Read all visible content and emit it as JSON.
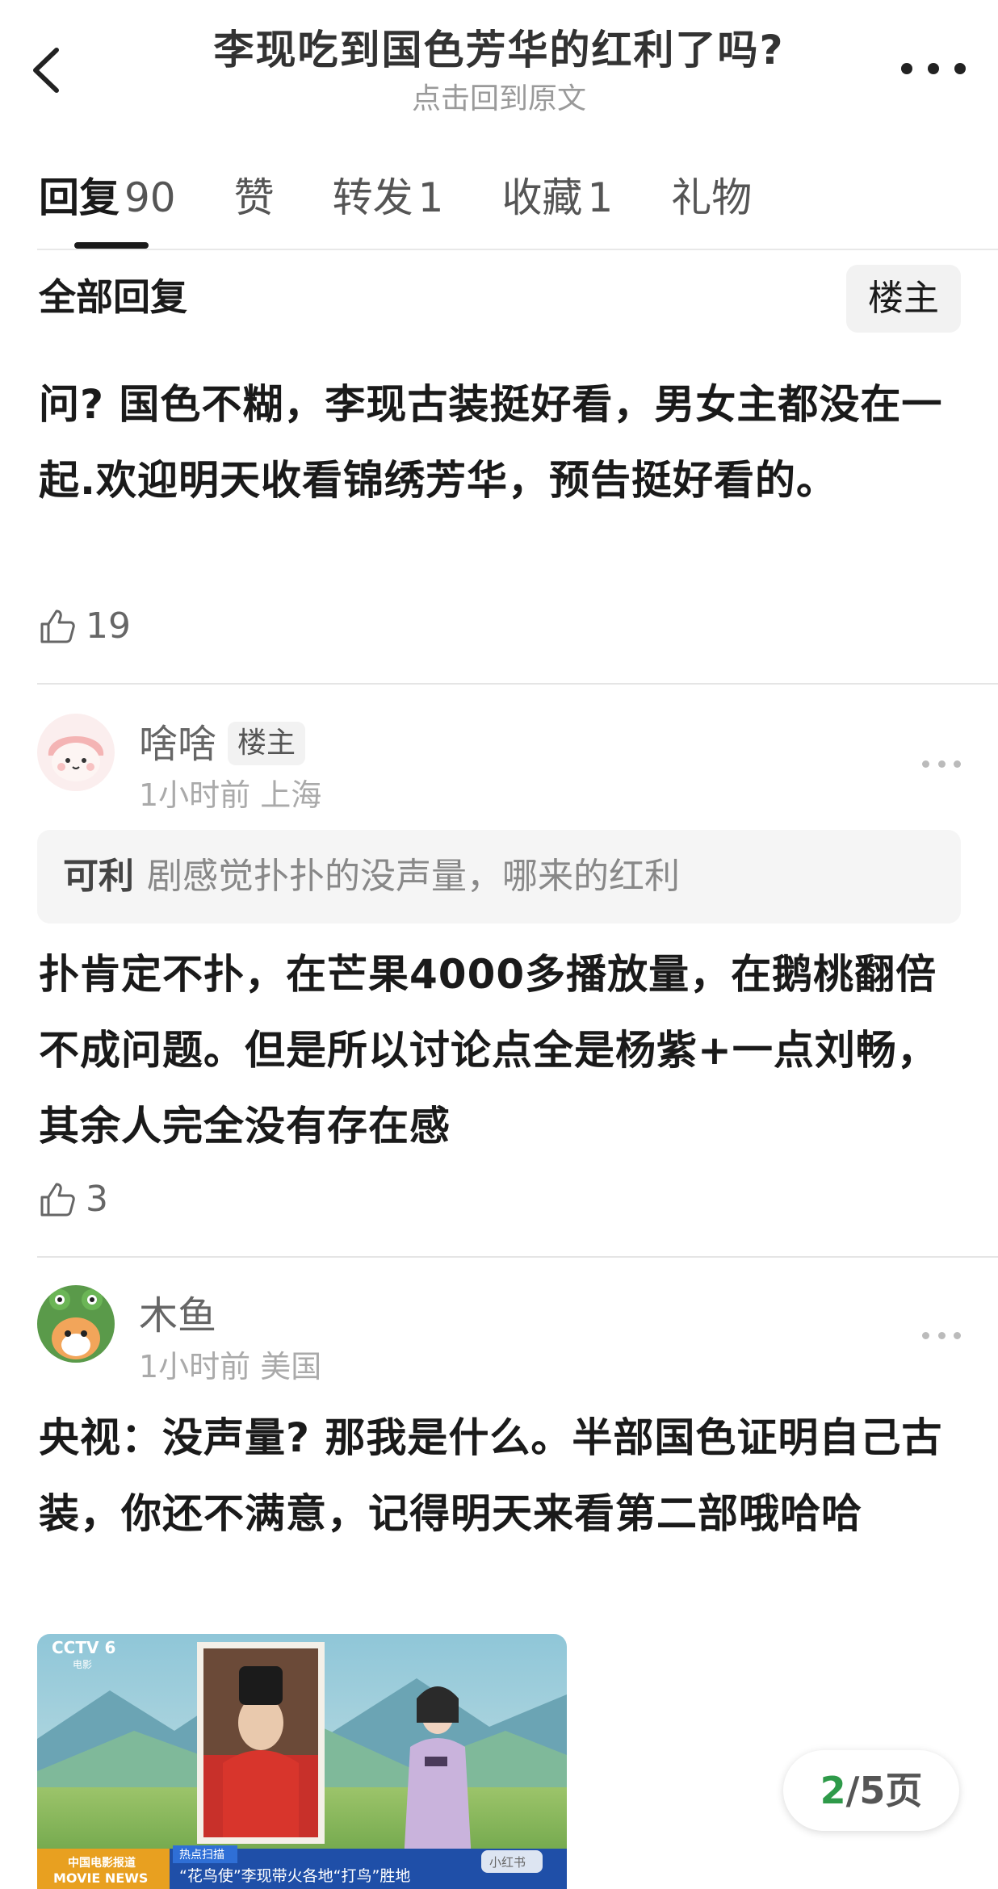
{
  "header": {
    "title": "李现吃到国色芳华的红利了吗?",
    "subtitle": "点击回到原文"
  },
  "tabs": [
    {
      "label": "回复",
      "count": "90"
    },
    {
      "label": "赞",
      "count": ""
    },
    {
      "label": "转发",
      "count": "1"
    },
    {
      "label": "收藏",
      "count": "1"
    },
    {
      "label": "礼物",
      "count": ""
    }
  ],
  "section": {
    "title": "全部回复",
    "owner_filter": "楼主"
  },
  "comments": [
    {
      "text": "问? 国色不糊，李现古装挺好看，男女主都没在一起.欢迎明天收看锦绣芳华，预告挺好看的。",
      "likes": "19"
    },
    {
      "username": "啥啥",
      "badge": "楼主",
      "time": "1小时前",
      "location": "上海",
      "quote_name": "可利",
      "quote_text": "剧感觉扑扑的没声量，哪来的红利",
      "text": "扑肯定不扑，在芒果4000多播放量，在鹅桃翻倍不成问题。但是所以讨论点全是杨紫+一点刘畅，其余人完全没有存在感",
      "likes": "3"
    },
    {
      "username": "木鱼",
      "time": "1小时前",
      "location": "美国",
      "text": "央视：没声量? 那我是什么。半部国色证明自己古装，你还不满意，记得明天来看第二部哦哈哈"
    }
  ],
  "image": {
    "channel": "CCTV 6",
    "channel_sub": "电影",
    "brand": "中国电影报道",
    "brand_en": "MOVIE NEWS",
    "banner_tag": "热点扫描",
    "headline": "“花鸟使”李现带火各地“打鸟”胜地",
    "watermark": "小红书"
  },
  "pager": {
    "current": "2",
    "total": "/5页"
  },
  "colors": {
    "accent_green": "#2e9a49",
    "text_primary": "#1a1a1a",
    "text_secondary": "#666666",
    "text_muted": "#aaaaaa"
  }
}
